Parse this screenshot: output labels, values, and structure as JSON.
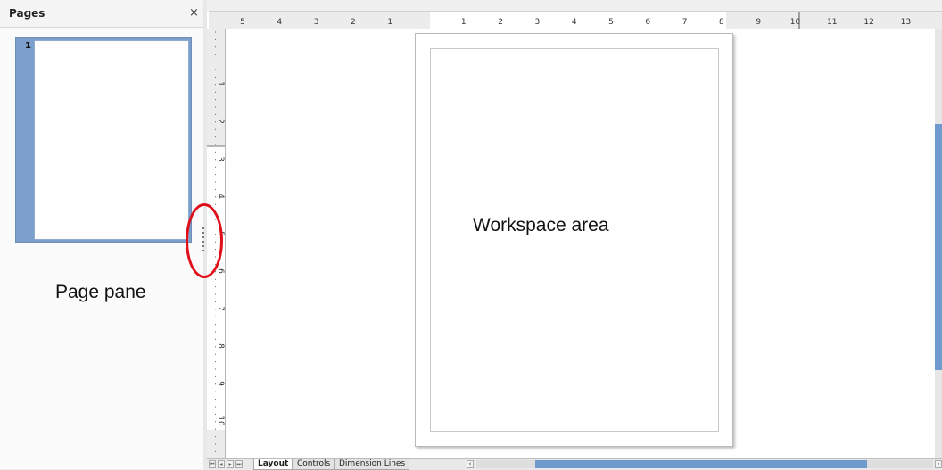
{
  "pages_pane": {
    "title": "Pages",
    "close_glyph": "×",
    "thumbnails": [
      {
        "number": "1"
      }
    ],
    "annotation_label": "Page pane"
  },
  "workspace": {
    "annotation_label": "Workspace area"
  },
  "horizontal_ruler": {
    "labels": [
      "5",
      "4",
      "3",
      "2",
      "1",
      "1",
      "2",
      "3",
      "4",
      "5",
      "6",
      "7",
      "8",
      "9",
      "10",
      "11",
      "12",
      "13"
    ]
  },
  "vertical_ruler": {
    "labels": [
      "1",
      "2",
      "3",
      "4",
      "5",
      "6",
      "7",
      "8",
      "9",
      "10"
    ]
  },
  "bottom_bar": {
    "nav_buttons": [
      "first-page",
      "previous-page",
      "next-page",
      "last-page"
    ],
    "tabs": [
      "Layout",
      "Controls",
      "Dimension Lines"
    ],
    "active_tab": "Layout"
  },
  "colors": {
    "selection": "#7c9fcc",
    "scrollbar_thumb": "#6f9ad0",
    "highlight_circle": "#e0101a"
  }
}
